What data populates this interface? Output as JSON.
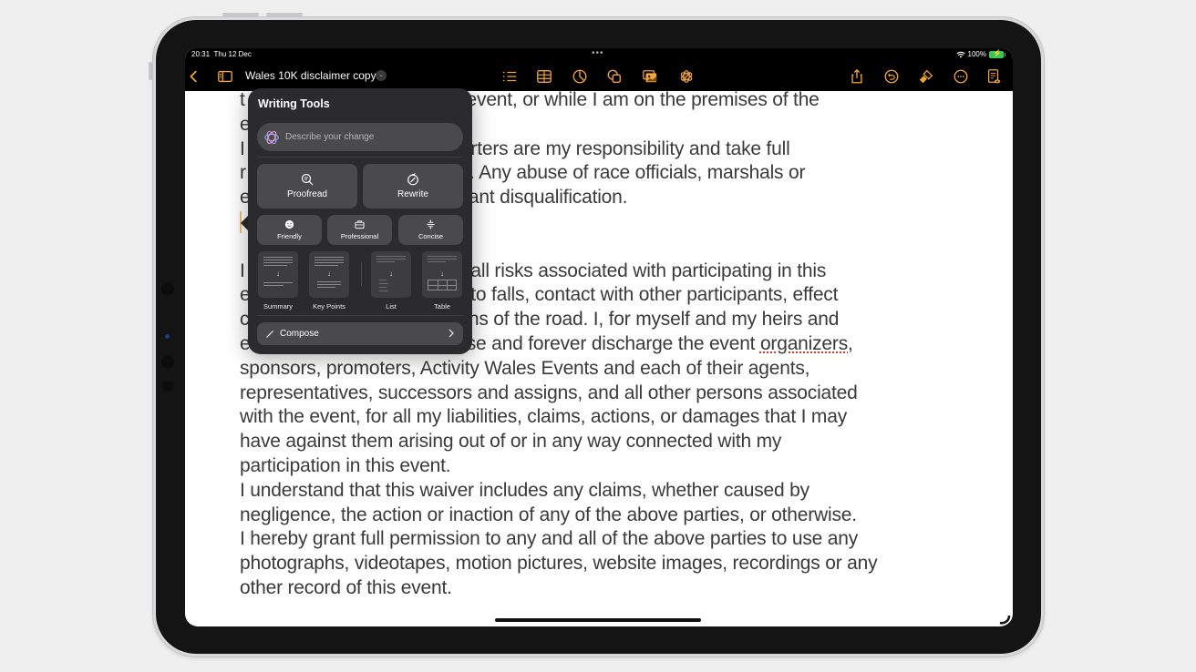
{
  "status_bar": {
    "time": "20:31",
    "date": "Thu 12 Dec",
    "battery": "100%",
    "multitask_dots": "•••"
  },
  "toolbar": {
    "document_title": "Wales 10K disclaimer copy",
    "accent_color": "#f2a33a",
    "left_icons": [
      "back-chevron-icon",
      "sidebar-icon"
    ],
    "center_icons": [
      "list-icon",
      "table-icon",
      "chart-icon",
      "shapes-icon",
      "media-icon",
      "apple-intelligence-icon"
    ],
    "right_icons": [
      "share-icon",
      "undo-icon",
      "format-brush-icon",
      "more-icon",
      "reading-view-icon"
    ]
  },
  "writing_tools": {
    "title": "Writing Tools",
    "input_placeholder": "Describe your change",
    "primary_actions": [
      {
        "label": "Proofread",
        "icon": "proofread-icon"
      },
      {
        "label": "Rewrite",
        "icon": "rewrite-icon"
      }
    ],
    "tone_actions": [
      {
        "label": "Friendly",
        "icon": "smiley-icon"
      },
      {
        "label": "Professional",
        "icon": "briefcase-icon"
      },
      {
        "label": "Concise",
        "icon": "concise-icon"
      }
    ],
    "format_actions": [
      {
        "label": "Summary"
      },
      {
        "label": "Key Points"
      },
      {
        "label": "List"
      },
      {
        "label": "Table"
      }
    ],
    "compose_label": "Compose"
  },
  "document": {
    "lines": [
      {
        "text": "t                                  g the event, or while I am on the premises of the"
      },
      {
        "text": "e"
      },
      {
        "text": "I                                  supporters are my responsibility and take full"
      },
      {
        "text": "r                                  ctions. Any abuse of race officials, marshals or"
      },
      {
        "text": "e                                  y instant disqualification."
      },
      {
        "text": ""
      },
      {
        "text": ""
      },
      {
        "text": "I                                  sume all risks associated with participating in this"
      },
      {
        "text": "e                                  nited to falls, contact with other participants, effect"
      },
      {
        "text": "c                                  nditions of the road. I, for myself and my heirs and"
      },
      {
        "text": "e                                  release and forever discharge the event ",
        "misspelled": "organizers",
        "after": ","
      },
      {
        "text": "sponsors, promoters, Activity Wales Events and each of their agents,"
      },
      {
        "text": "representatives, successors and assigns, and all other persons associated"
      },
      {
        "text": "with the event, for all my liabilities, claims, actions, or damages that I may"
      },
      {
        "text": "have against them arising out of or in any way connected with my"
      },
      {
        "text": "participation in this event."
      },
      {
        "text": "I understand that this waiver includes any claims, whether caused by"
      },
      {
        "text": "negligence, the action or inaction of any of the above parties, or otherwise."
      },
      {
        "text": "I hereby grant full permission to any and all of the above parties to use any"
      },
      {
        "text": "photographs, videotapes, motion pictures, website images, recordings or any"
      },
      {
        "text": "other record of this event."
      }
    ]
  }
}
